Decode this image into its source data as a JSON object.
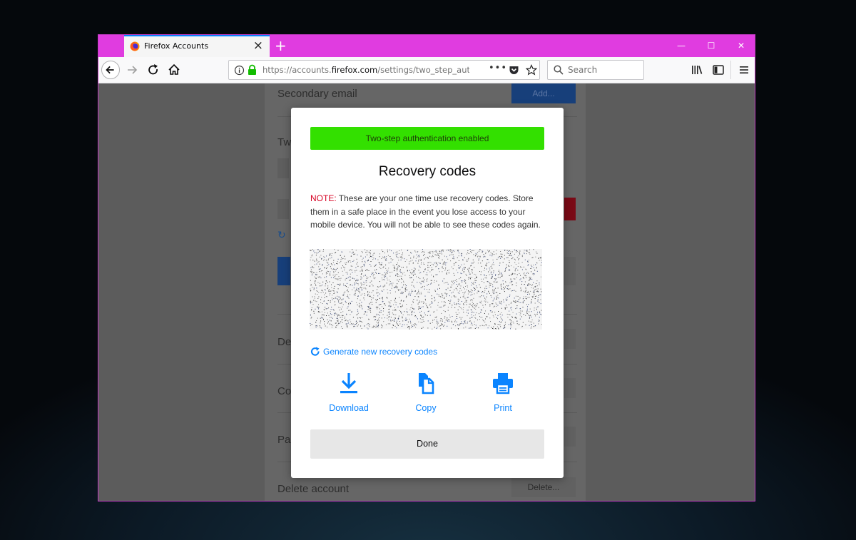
{
  "browser": {
    "tab_title": "Firefox Accounts",
    "url_prefix": "https://accounts.",
    "url_domain": "firefox.com",
    "url_path": "/settings/two_step_auth",
    "search_placeholder": "Search"
  },
  "page": {
    "rows": [
      {
        "label": "Secondary email",
        "button": "Add..."
      },
      {
        "label": "Tw",
        "button": ""
      },
      {
        "label": "De",
        "button": ""
      },
      {
        "label": "Co",
        "button": ""
      },
      {
        "label": "Pa",
        "button": ""
      },
      {
        "label": "Delete account",
        "button": "Delete..."
      }
    ]
  },
  "modal": {
    "banner": "Two-step authentication enabled",
    "title": "Recovery codes",
    "note_prefix": "NOTE:",
    "note_text": " These are your one time use recovery codes. Store them in a safe place in the event you lose access to your mobile device. You will not be able to see these codes again.",
    "generate_link": "Generate new recovery codes",
    "actions": {
      "download": "Download",
      "copy": "Copy",
      "print": "Print"
    },
    "done": "Done"
  },
  "colors": {
    "accent": "#0a84ff",
    "success": "#33e000",
    "titlebar": "#e03ce0",
    "note_red": "#d70022"
  }
}
